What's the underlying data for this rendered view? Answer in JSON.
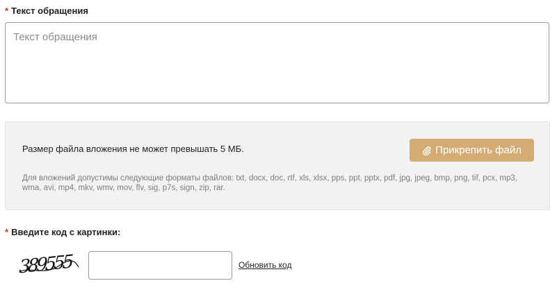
{
  "message": {
    "required_mark": "*",
    "label": "Текст обращения",
    "placeholder": "Текст обращения",
    "value": ""
  },
  "attachment": {
    "size_note": "Размер файла вложения не может превышать 5 МБ.",
    "button_label": "Прикрепить файл",
    "button_icon": "paperclip-icon",
    "button_color": "#d4ab72",
    "formats_text": "Для вложений допустимы следующие форматы файлов: txt, docx, doc, rtf, xls, xlsx, pps, ppt, pptx, pdf, jpg, jpeg, bmp, png, tif, pcx, mp3, wma, avi, mp4, mkv, wmv, mov, flv, sig, p7s, sign, zip, rar."
  },
  "captcha": {
    "required_mark": "*",
    "label": "Введите код с картинки:",
    "image_code": "389555",
    "input_value": "",
    "refresh_label": "Обновить код"
  },
  "colors": {
    "required": "#d0311f",
    "panel_bg": "#f2f2f2"
  }
}
